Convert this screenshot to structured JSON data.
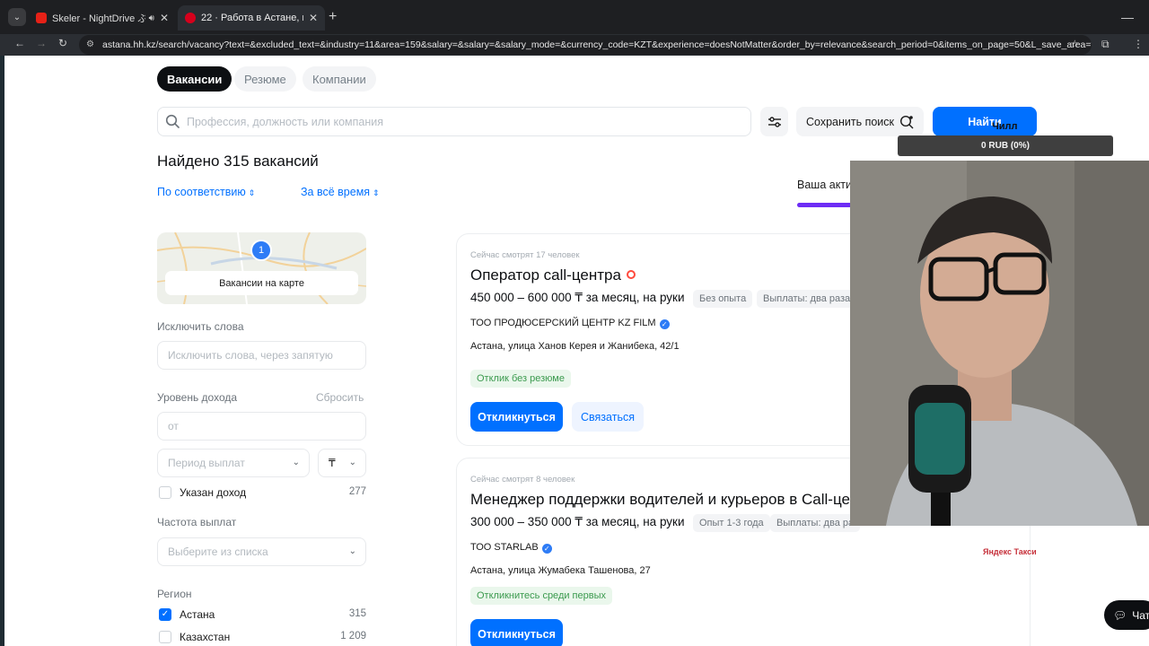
{
  "browser": {
    "tabs": [
      {
        "title": "Skeler - NightDrive ぶ",
        "active": false
      },
      {
        "title": "22 · Работа в Астане, поиск п",
        "active": true
      }
    ],
    "url": "astana.hh.kz/search/vacancy?text=&excluded_text=&industry=11&area=159&salary=&salary=&salary_mode=&currency_code=KZT&experience=doesNotMatter&order_by=relevance&search_period=0&items_on_page=50&L_save_area=true&hht..."
  },
  "nav": {
    "tabs": [
      "Вакансии",
      "Резюме",
      "Компании"
    ],
    "active_tab": "Вакансии"
  },
  "search": {
    "placeholder": "Профессия, должность или компания",
    "save_label": "Сохранить поиск",
    "find_label": "Найти"
  },
  "results": {
    "found_text": "Найдено 315 вакансий",
    "sort_label": "По соответствию",
    "period_label": "За всё время",
    "activity_label": "Ваша активность"
  },
  "filters": {
    "map_label": "Вакансии на карте",
    "map_pin_count": "1",
    "exclude_label": "Исключить слова",
    "exclude_placeholder": "Исключить слова, через запятую",
    "income_label": "Уровень дохода",
    "income_reset": "Сбросить",
    "income_from_placeholder": "от",
    "pay_period_placeholder": "Период выплат",
    "currency_symbol": "₸",
    "income_shown_label": "Указан доход",
    "income_shown_count": "277",
    "frequency_label": "Частота выплат",
    "frequency_placeholder": "Выберите из списка",
    "region_label": "Регион",
    "regions": [
      {
        "name": "Астана",
        "count": "315",
        "checked": true
      },
      {
        "name": "Казахстан",
        "count": "1 209",
        "checked": false
      }
    ]
  },
  "vacancies": [
    {
      "watching": "Сейчас смотрят 17 человек",
      "title": "Оператор call-центра",
      "salary": "450 000 – 600 000 ₸ за месяц, на руки",
      "tags": [
        "Без опыта",
        "Выплаты: два раза"
      ],
      "company": "ТОО ПРОДЮСЕРСКИЙ ЦЕНТР KZ FILM",
      "address": "Астана, улица Ханов Керея и Жанибека, 42/1",
      "badge": "Отклик без резюме",
      "apply_label": "Откликнуться",
      "contact_label": "Связаться"
    },
    {
      "watching": "Сейчас смотрят 8 человек",
      "title": "Менеджер поддержки водителей и курьеров в Call-це",
      "salary": "300 000 – 350 000 ₸ за месяц, на руки",
      "tags": [
        "Опыт 1-3 года",
        "Выплаты: два ра"
      ],
      "company": "ТОО STARLAB",
      "address": "Астана, улица Жумабека Ташенова, 27",
      "badge": "Откликнитесь среди первых",
      "apply_label": "Откликнуться",
      "logo_text": "Яндекс Такси"
    }
  ],
  "overlay": {
    "label": "Чилл",
    "bar_text": "0 RUB (0%)",
    "chat_label": "Чат"
  },
  "colors": {
    "accent": "#0070ff",
    "activity": "#6d2cf5",
    "success": "#3b9a4e"
  }
}
